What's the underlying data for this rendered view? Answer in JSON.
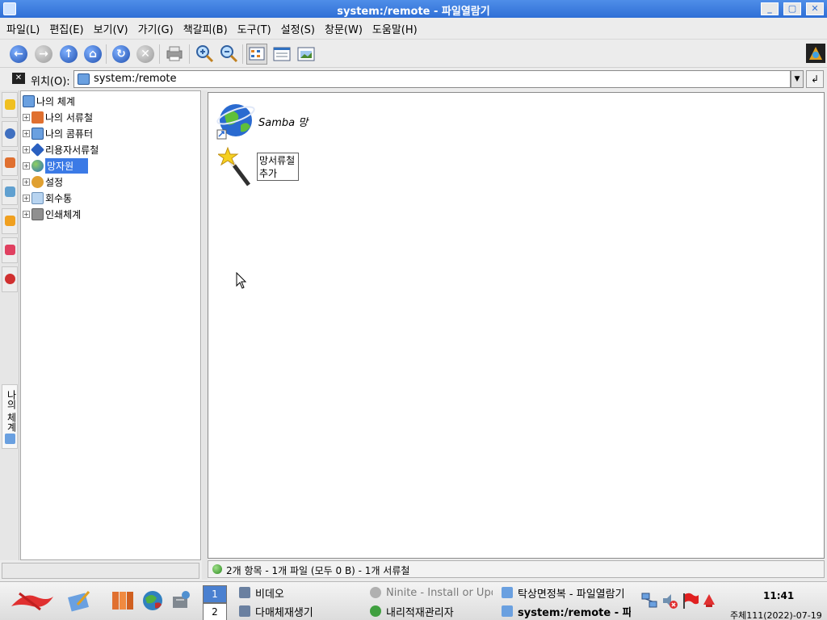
{
  "window": {
    "title": "system:/remote - 파일열람기"
  },
  "menubar": [
    "파일(L)",
    "편집(E)",
    "보기(V)",
    "가기(G)",
    "책갈피(B)",
    "도구(T)",
    "설정(S)",
    "창문(W)",
    "도움말(H)"
  ],
  "toolbar": {
    "buttons": [
      "back-icon",
      "forward-icon",
      "up-icon",
      "home-icon",
      "reload-icon",
      "stop-icon",
      "print-icon",
      "zoom-in-icon",
      "zoom-out-icon",
      "icon-view-icon",
      "detail-view-icon",
      "preview-icon"
    ]
  },
  "location": {
    "label": "위치(O):",
    "value": "system:/remote"
  },
  "sidebar": {
    "vertical_tab_label": "나의 체계",
    "tree": [
      {
        "label": "나의 체계",
        "level": 0,
        "icon": "computer-icon",
        "selected": false
      },
      {
        "label": "나의 서류철",
        "level": 1,
        "icon": "documents-folder-icon",
        "selected": false
      },
      {
        "label": "나의 콤퓨터",
        "level": 1,
        "icon": "computer-icon",
        "selected": false
      },
      {
        "label": "리용자서류철",
        "level": 1,
        "icon": "user-folder-icon",
        "selected": false
      },
      {
        "label": "망자원",
        "level": 1,
        "icon": "network-globe-icon",
        "selected": true
      },
      {
        "label": "설정",
        "level": 1,
        "icon": "settings-gears-icon",
        "selected": false
      },
      {
        "label": "회수통",
        "level": 1,
        "icon": "trash-icon",
        "selected": false
      },
      {
        "label": "인쇄체계",
        "level": 1,
        "icon": "printer-icon",
        "selected": false
      }
    ]
  },
  "main": {
    "items": [
      {
        "label": "Samba 망",
        "icon": "network-globe-icon"
      },
      {
        "label_line1": "망서류철",
        "label_line2": "추가",
        "icon": "magic-wand-icon"
      }
    ]
  },
  "status": {
    "text": "2개 항목 - 1개 파일 (모두 0 B) - 1개 서류철"
  },
  "taskbar": {
    "desktops": [
      "1",
      "2"
    ],
    "tasks": [
      {
        "label": "비데오",
        "icon": "video-icon"
      },
      {
        "label": "다매체재생기",
        "icon": "media-player-icon"
      },
      {
        "label": "Ninite - Install or Upd",
        "icon": "globe-icon"
      },
      {
        "label": "내리적재관리자",
        "icon": "download-icon"
      },
      {
        "label": "탁상면정복 - 파일열람기",
        "icon": "folder-icon"
      },
      {
        "label": "system:/remote - 파",
        "icon": "folder-icon"
      }
    ],
    "clock": "11:41",
    "date": "주체111(2022)-07-19"
  },
  "colors": {
    "selection": "#3b7ae6",
    "titlebar": "#2f6fd6"
  }
}
